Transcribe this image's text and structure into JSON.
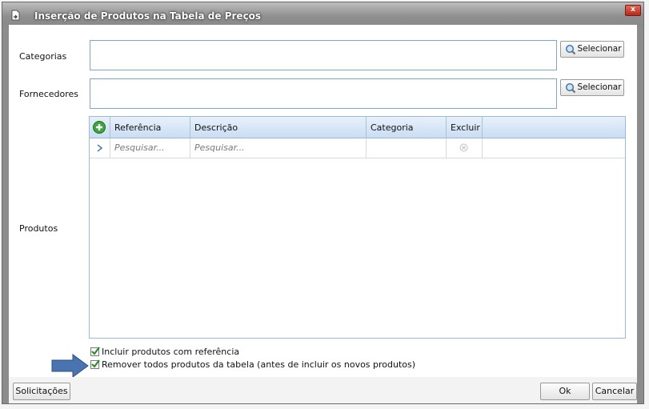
{
  "window": {
    "title": "Inserção de Produtos na Tabela de Preços",
    "close_label": "x"
  },
  "fields": {
    "categorias_label": "Categorias",
    "categorias_value": "",
    "fornecedores_label": "Fornecedores",
    "fornecedores_value": "",
    "selecionar_label": "Selecionar",
    "produtos_label": "Produtos"
  },
  "grid": {
    "columns": [
      "Referência",
      "Descrição",
      "Categoria",
      "Excluir"
    ],
    "filter_row": {
      "referencia_placeholder": "Pesquisar...",
      "descricao_placeholder": "Pesquisar..."
    }
  },
  "options": {
    "incluir_label": "Incluir produtos com referência",
    "incluir_checked": true,
    "remover_label": "Remover todos produtos da tabela (antes de incluir os novos produtos)",
    "remover_checked": true
  },
  "footer": {
    "solicitacoes_label": "Solicitações",
    "ok_label": "Ok",
    "cancelar_label": "Cancelar"
  },
  "colors": {
    "accent_border": "#7fa6c9",
    "header_gradient_top": "#e8f1fb",
    "header_gradient_bottom": "#c9ddf3",
    "arrow": "#4a74b0",
    "check_green": "#2e8b2e"
  },
  "icons": [
    "document-arrow-icon",
    "magnifier-icon",
    "add-circle-icon",
    "chevron-right-icon",
    "remove-x-icon",
    "checkmark-icon",
    "arrow-right-icon"
  ]
}
